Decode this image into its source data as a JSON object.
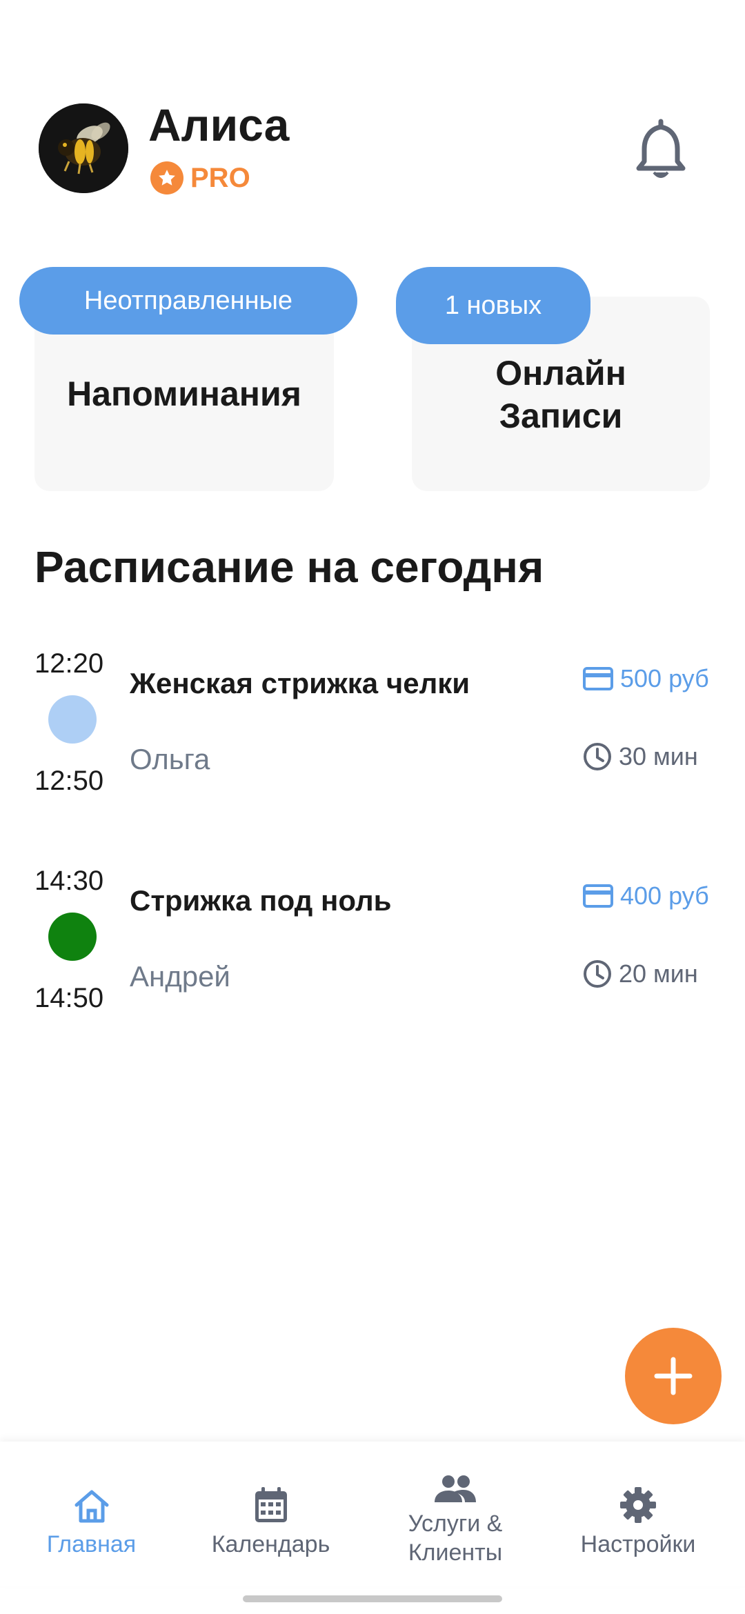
{
  "header": {
    "user_name": "Алиса",
    "badge": "PRO",
    "avatar_icon": "bee-avatar",
    "notification_icon": "bell-icon"
  },
  "cards": {
    "reminders": {
      "pill": "Неотправленные",
      "title": "Напоминания"
    },
    "online": {
      "pill": "1 новых",
      "title_line1": "Онлайн",
      "title_line2": "Записи"
    }
  },
  "schedule": {
    "title": "Расписание на сегодня",
    "appointments": [
      {
        "start": "12:20",
        "end": "12:50",
        "service": "Женская стрижка челки",
        "client": "Ольга",
        "price": "500 руб",
        "duration": "30 мин",
        "color": "#aecff5"
      },
      {
        "start": "14:30",
        "end": "14:50",
        "service": "Стрижка под ноль",
        "client": "Андрей",
        "price": "400 руб",
        "duration": "20 мин",
        "color": "#0f820f"
      }
    ]
  },
  "fab": {
    "icon": "plus-icon"
  },
  "nav": {
    "home": "Главная",
    "calendar": "Календарь",
    "services_line1": "Услуги &",
    "services_line2": "Клиенты",
    "settings": "Настройки"
  },
  "colors": {
    "accent_blue": "#5b9de8",
    "accent_orange": "#f5893a",
    "muted": "#6f7a8a"
  }
}
